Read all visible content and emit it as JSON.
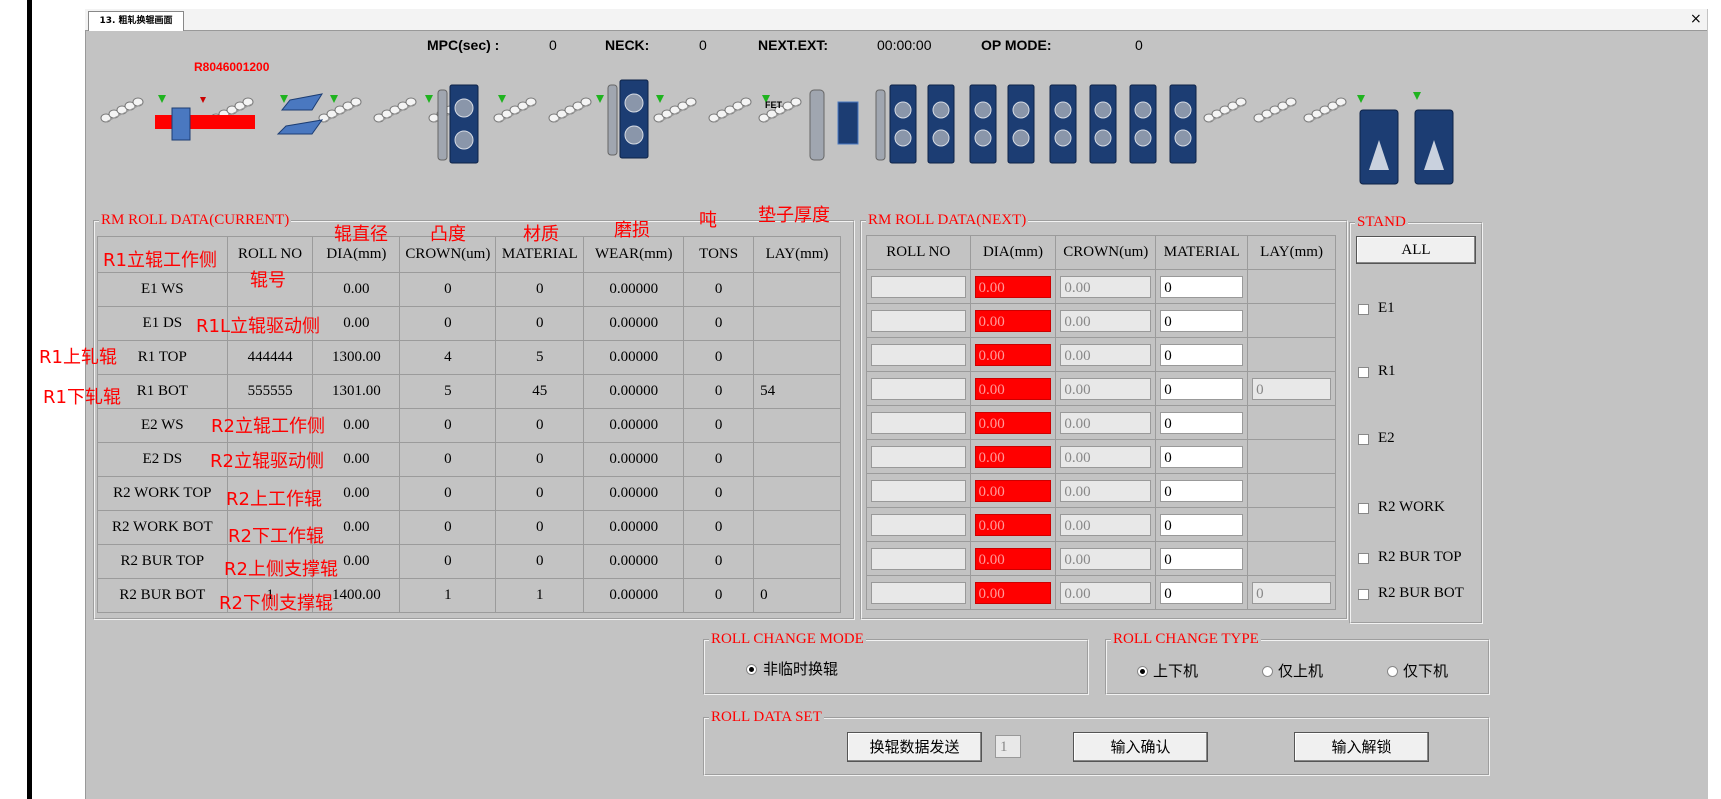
{
  "window": {
    "tab_title": "13. 粗轧换辊画面",
    "close": "×"
  },
  "status": {
    "mpc_label": "MPC(sec) :",
    "mpc_value": "0",
    "neck_label": "NECK:",
    "neck_value": "0",
    "next_ext_label": "NEXT.EXT:",
    "next_ext_value": "00:00:00",
    "op_mode_label": "OP MODE:",
    "op_mode_value": "0"
  },
  "slab_id": "R8046001200",
  "fet_label": "FET",
  "current": {
    "legend": "RM ROLL DATA(CURRENT)",
    "headers": [
      "",
      "ROLL NO",
      "DIA(mm)",
      "CROWN(um)",
      "MATERIAL",
      "WEAR(mm)",
      "TONS",
      "LAY(mm)"
    ],
    "rows": [
      [
        "E1 WS",
        "",
        "0.00",
        "0",
        "0",
        "0.00000",
        "0",
        ""
      ],
      [
        "E1 DS",
        "",
        "0.00",
        "0",
        "0",
        "0.00000",
        "0",
        ""
      ],
      [
        "R1 TOP",
        "444444",
        "1300.00",
        "4",
        "5",
        "0.00000",
        "0",
        ""
      ],
      [
        "R1 BOT",
        "555555",
        "1301.00",
        "5",
        "45",
        "0.00000",
        "0",
        "54"
      ],
      [
        "E2 WS",
        "",
        "0.00",
        "0",
        "0",
        "0.00000",
        "0",
        ""
      ],
      [
        "E2 DS",
        "",
        "0.00",
        "0",
        "0",
        "0.00000",
        "0",
        ""
      ],
      [
        "R2 WORK TOP",
        "",
        "0.00",
        "0",
        "0",
        "0.00000",
        "0",
        ""
      ],
      [
        "R2 WORK BOT",
        "",
        "0.00",
        "0",
        "0",
        "0.00000",
        "0",
        ""
      ],
      [
        "R2 BUR TOP",
        "",
        "0.00",
        "0",
        "0",
        "0.00000",
        "0",
        ""
      ],
      [
        "R2 BUR BOT",
        "1",
        "1400.00",
        "1",
        "1",
        "0.00000",
        "0",
        "0"
      ]
    ]
  },
  "next": {
    "legend": "RM ROLL DATA(NEXT)",
    "headers": [
      "ROLL NO",
      "DIA(mm)",
      "CROWN(um)",
      "MATERIAL",
      "LAY(mm)"
    ],
    "rows": [
      {
        "roll_no": "",
        "dia": "0.00",
        "crown": "0.00",
        "material": "0",
        "lay": null
      },
      {
        "roll_no": "",
        "dia": "0.00",
        "crown": "0.00",
        "material": "0",
        "lay": null
      },
      {
        "roll_no": "",
        "dia": "0.00",
        "crown": "0.00",
        "material": "0",
        "lay": null
      },
      {
        "roll_no": "",
        "dia": "0.00",
        "crown": "0.00",
        "material": "0",
        "lay": "0"
      },
      {
        "roll_no": "",
        "dia": "0.00",
        "crown": "0.00",
        "material": "0",
        "lay": null
      },
      {
        "roll_no": "",
        "dia": "0.00",
        "crown": "0.00",
        "material": "0",
        "lay": null
      },
      {
        "roll_no": "",
        "dia": "0.00",
        "crown": "0.00",
        "material": "0",
        "lay": null
      },
      {
        "roll_no": "",
        "dia": "0.00",
        "crown": "0.00",
        "material": "0",
        "lay": null
      },
      {
        "roll_no": "",
        "dia": "0.00",
        "crown": "0.00",
        "material": "0",
        "lay": null
      },
      {
        "roll_no": "",
        "dia": "0.00",
        "crown": "0.00",
        "material": "0",
        "lay": "0"
      }
    ]
  },
  "stand": {
    "legend": "STAND",
    "all_button": "ALL",
    "items": [
      "E1",
      "R1",
      "E2",
      "R2 WORK",
      "R2 BUR TOP",
      "R2 BUR BOT"
    ]
  },
  "roll_change_mode": {
    "legend": "ROLL CHANGE MODE",
    "option": "非临时换辊"
  },
  "roll_change_type": {
    "legend": "ROLL CHANGE TYPE",
    "options": [
      "上下机",
      "仅上机",
      "仅下机"
    ],
    "selected": 0
  },
  "roll_data_set": {
    "legend": "ROLL DATA SET",
    "send_button": "换辊数据发送",
    "count_value": "1",
    "confirm_button": "输入确认",
    "unlock_button": "输入解锁"
  },
  "annotations": {
    "dia": "辊直径",
    "crown": "凸度",
    "material": "材质",
    "wear": "磨损",
    "tons": "吨",
    "lay": "垫子厚度",
    "e1ws": "R1立辊工作侧",
    "rollno": "辊号",
    "e1ds": "R1L立辊驱动侧",
    "r1top": "R1上轧辊",
    "r1bot": "R1下轧辊",
    "e2ws": "R2立辊工作侧",
    "e2ds": "R2立辊驱动侧",
    "r2wtop": "R2上工作辊",
    "r2wbot": "R2下工作辊",
    "r2btop": "R2上侧支撑辊",
    "r2bbot": "R2下侧支撑辊"
  },
  "colors": {
    "panel": "#c3c3c3",
    "alert_red": "#ff0000",
    "stand_blue": "#1c3d73"
  }
}
